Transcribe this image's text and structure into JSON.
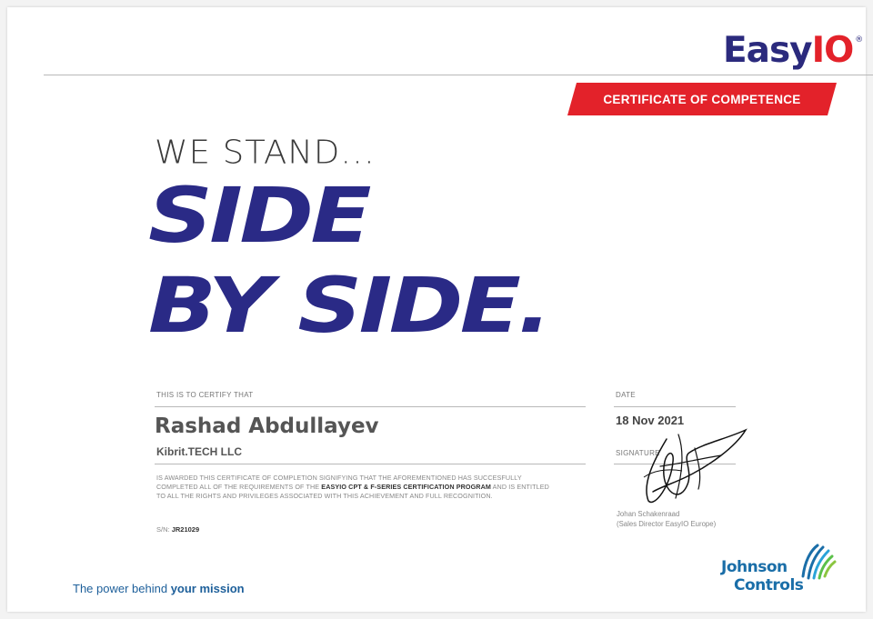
{
  "logo": {
    "part1": "Easy",
    "part2": "IO",
    "reg": "®"
  },
  "banner": {
    "label": "CERTIFICATE OF COMPETENCE"
  },
  "headline": {
    "intro": "WE STAND...",
    "line1": "SIDE",
    "line2": "BY SIDE."
  },
  "certify": {
    "label": "THIS IS TO CERTIFY THAT",
    "name": "Rashad Abdullayev",
    "company": "Kibrit.TECH LLC",
    "text_part1": "IS AWARDED THIS CERTIFICATE OF COMPLETION SIGNIFYING THAT THE AFOREMENTIONED HAS SUCCESFULLY COMPLETED ALL OF THE REQUIREMENTS OF THE ",
    "text_bold": "EASYIO CPT & F-SERIES CERTIFICATION PROGRAM",
    "text_part2": " AND IS ENTITLED TO ALL THE RIGHTS AND PRIVILEGES ASSOCIATED WITH THIS ACHIEVEMENT AND FULL RECOGNITION.",
    "sn_label": "S/N:",
    "sn_value": "JR21029"
  },
  "date": {
    "label": "DATE",
    "value": "18 Nov 2021"
  },
  "signature": {
    "label": "SIGNATURE",
    "name": "Johan Schakenraad",
    "title": "(Sales Director EasyIO Europe)"
  },
  "partner": {
    "line1": "Johnson",
    "line2": "Controls"
  },
  "footer": {
    "part1": "The power behind ",
    "part2": "your mission"
  },
  "colors": {
    "navy": "#2a2a86",
    "red": "#e3222a",
    "blue": "#1d5f9a"
  }
}
